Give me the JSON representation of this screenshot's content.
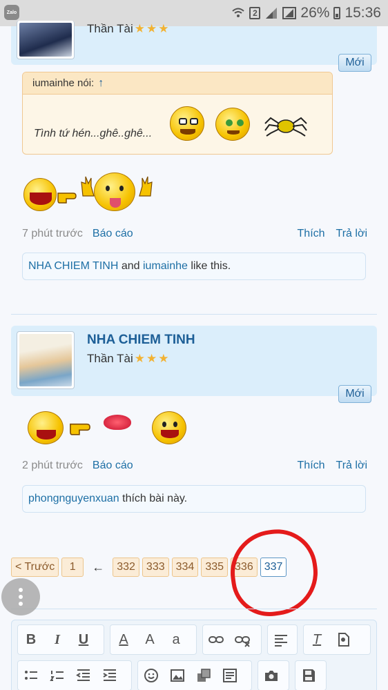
{
  "statusbar": {
    "app_badge": "Zalo",
    "sim": "2",
    "battery": "26%",
    "time": "15:36",
    "icons": [
      "wifi-icon",
      "signal-icon",
      "signal-icon",
      "battery-icon"
    ]
  },
  "post1": {
    "title": "Thần Tài",
    "new_button": "Mới",
    "quote": {
      "author": "iumainhe nói:",
      "arrow": "↑",
      "text": "Tình tứ hén...ghê..ghê..."
    },
    "time": "7 phút trước",
    "report": "Báo cáo",
    "like": "Thích",
    "reply": "Trả lời",
    "likes": {
      "user1": "NHA CHIEM TINH",
      "and": " and ",
      "user2": "iumainhe",
      "suffix": " like this."
    }
  },
  "post2": {
    "username": "NHA CHIEM TINH",
    "title": "Thần Tài",
    "new_button": "Mới",
    "time": "2 phút trước",
    "report": "Báo cáo",
    "like": "Thích",
    "reply": "Trả lời",
    "likes": {
      "user": "phongnguyenxuan",
      "suffix": " thích bài này."
    }
  },
  "pager": {
    "prev": "< Trước",
    "first": "1",
    "arrow": "←",
    "pages": [
      "332",
      "333",
      "334",
      "335",
      "336"
    ],
    "current": "337"
  },
  "editor": {
    "bold": "B",
    "italic": "I",
    "underline": "U",
    "font_color": "A",
    "font_size": "A",
    "font_family": "a",
    "clear_format": "T"
  },
  "colors": {
    "accent": "#1d5f97",
    "header_bg": "#dbeefb",
    "quote_bg": "#fdf6e7",
    "annotation_red": "#e41b1b"
  }
}
